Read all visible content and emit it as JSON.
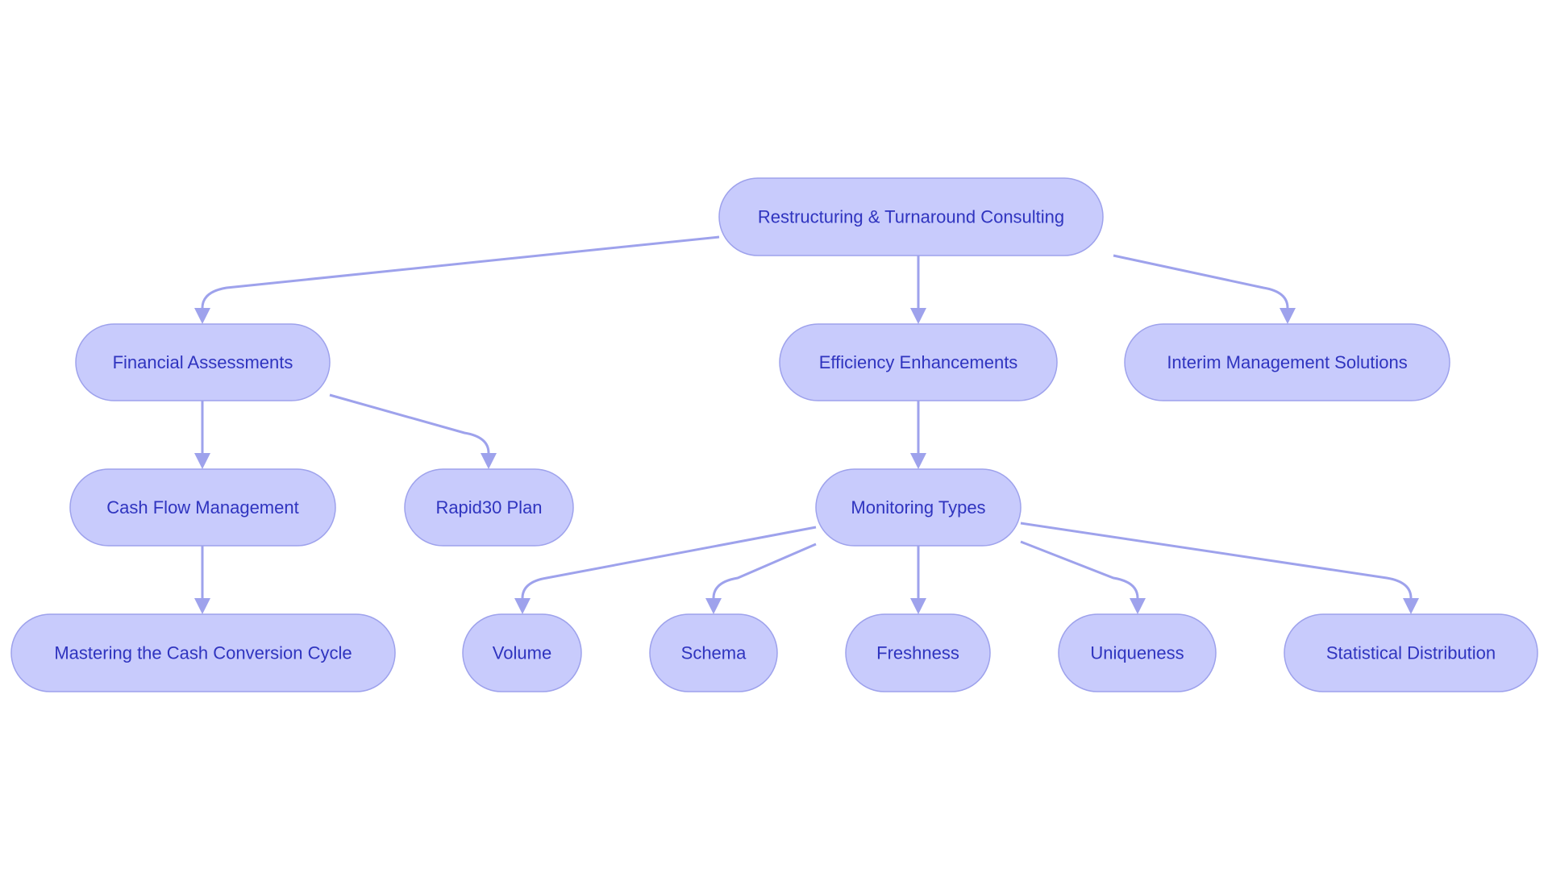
{
  "diagram": {
    "type": "tree",
    "colors": {
      "node_fill": "#c8cbfc",
      "node_border": "#9ea2ec",
      "edge": "#9ea2ec",
      "text": "#2f34bf",
      "background": "#ffffff"
    },
    "nodes": [
      {
        "id": "root",
        "label": "Restructuring & Turnaround Consulting"
      },
      {
        "id": "fa",
        "label": "Financial Assessments"
      },
      {
        "id": "ee",
        "label": "Efficiency Enhancements"
      },
      {
        "id": "ims",
        "label": "Interim Management Solutions"
      },
      {
        "id": "cfm",
        "label": "Cash Flow Management"
      },
      {
        "id": "r30",
        "label": "Rapid30 Plan"
      },
      {
        "id": "mt",
        "label": "Monitoring Types"
      },
      {
        "id": "mccc",
        "label": "Mastering the Cash Conversion Cycle"
      },
      {
        "id": "vol",
        "label": "Volume"
      },
      {
        "id": "sch",
        "label": "Schema"
      },
      {
        "id": "fre",
        "label": "Freshness"
      },
      {
        "id": "uni",
        "label": "Uniqueness"
      },
      {
        "id": "sd",
        "label": "Statistical Distribution"
      }
    ],
    "edges": [
      {
        "from": "root",
        "to": "fa"
      },
      {
        "from": "root",
        "to": "ee"
      },
      {
        "from": "root",
        "to": "ims"
      },
      {
        "from": "fa",
        "to": "cfm"
      },
      {
        "from": "fa",
        "to": "r30"
      },
      {
        "from": "cfm",
        "to": "mccc"
      },
      {
        "from": "ee",
        "to": "mt"
      },
      {
        "from": "mt",
        "to": "vol"
      },
      {
        "from": "mt",
        "to": "sch"
      },
      {
        "from": "mt",
        "to": "fre"
      },
      {
        "from": "mt",
        "to": "uni"
      },
      {
        "from": "mt",
        "to": "sd"
      }
    ]
  }
}
